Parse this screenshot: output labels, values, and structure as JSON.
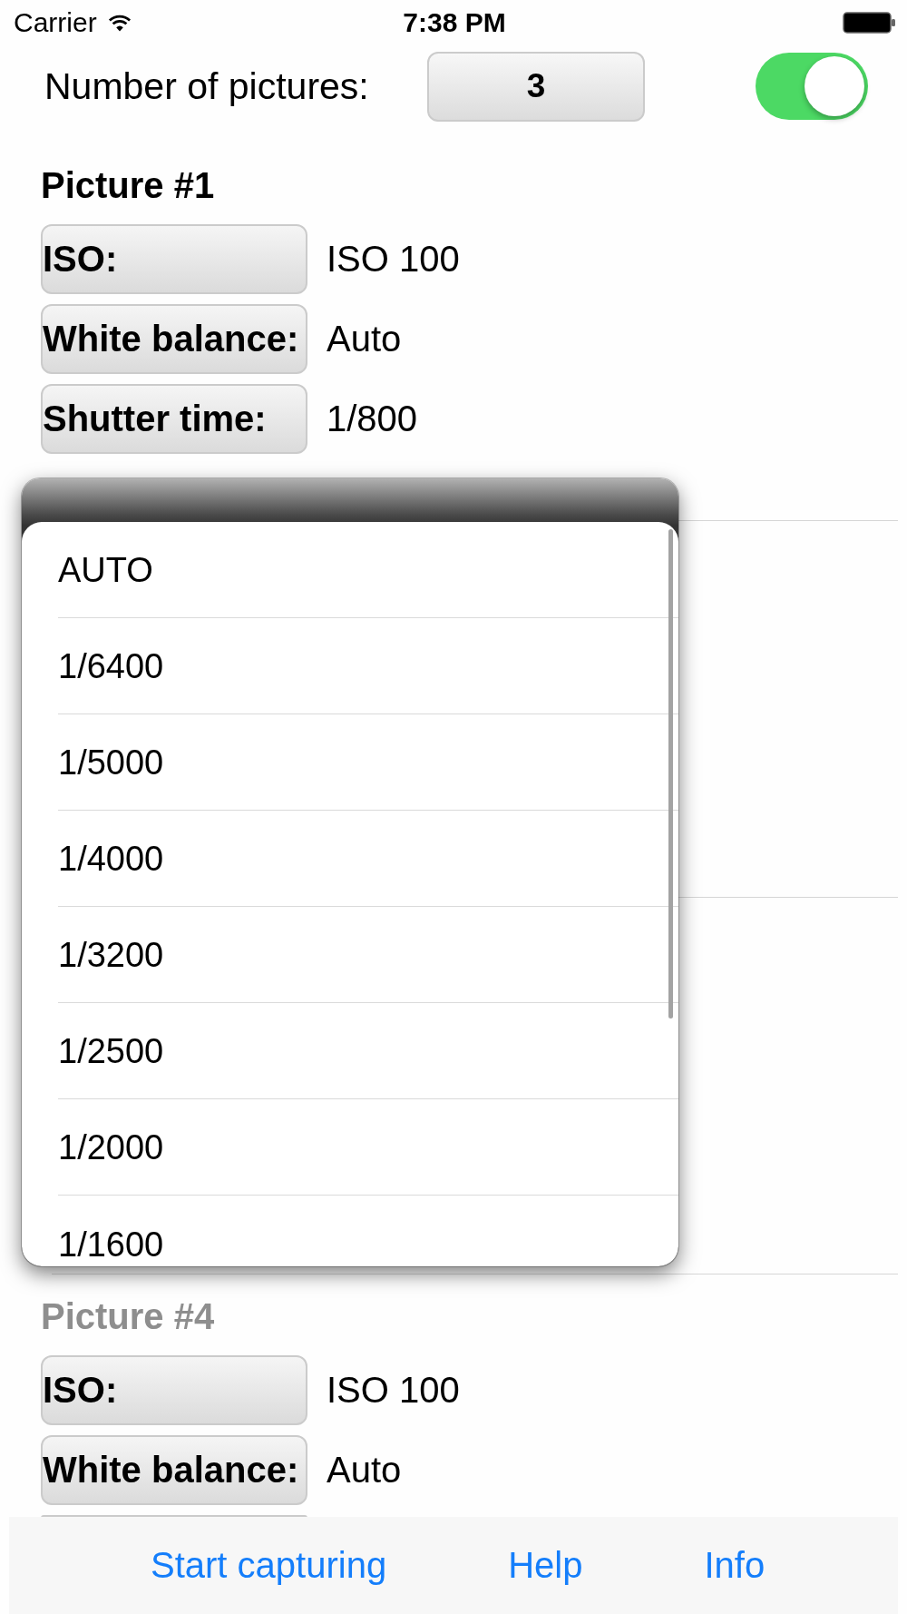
{
  "status_bar": {
    "carrier": "Carrier",
    "time": "7:38 PM"
  },
  "picture_count": {
    "label": "Number of pictures:",
    "value": "3",
    "switch": {
      "on": true
    }
  },
  "sections": [
    {
      "title": "Picture #1",
      "disabled": false,
      "rows": [
        {
          "kind": "setting",
          "label": "ISO:",
          "value": "ISO 100"
        },
        {
          "kind": "setting",
          "label": "White balance:",
          "value": "Auto"
        },
        {
          "kind": "setting",
          "label": "Shutter time:",
          "value": "1/800"
        }
      ]
    },
    {
      "title": "Picture #4",
      "disabled": true,
      "rows": [
        {
          "kind": "setting",
          "label": "ISO:",
          "value": "ISO 100"
        },
        {
          "kind": "setting",
          "label": "White balance:",
          "value": "Auto"
        },
        {
          "kind": "cut_off"
        }
      ]
    }
  ],
  "picker": {
    "options": [
      "AUTO",
      "1/6400",
      "1/5000",
      "1/4000",
      "1/3200",
      "1/2500",
      "1/2000",
      "1/1600"
    ]
  },
  "toolbar": {
    "buttons": [
      "Start capturing",
      "Help",
      "Info"
    ]
  }
}
